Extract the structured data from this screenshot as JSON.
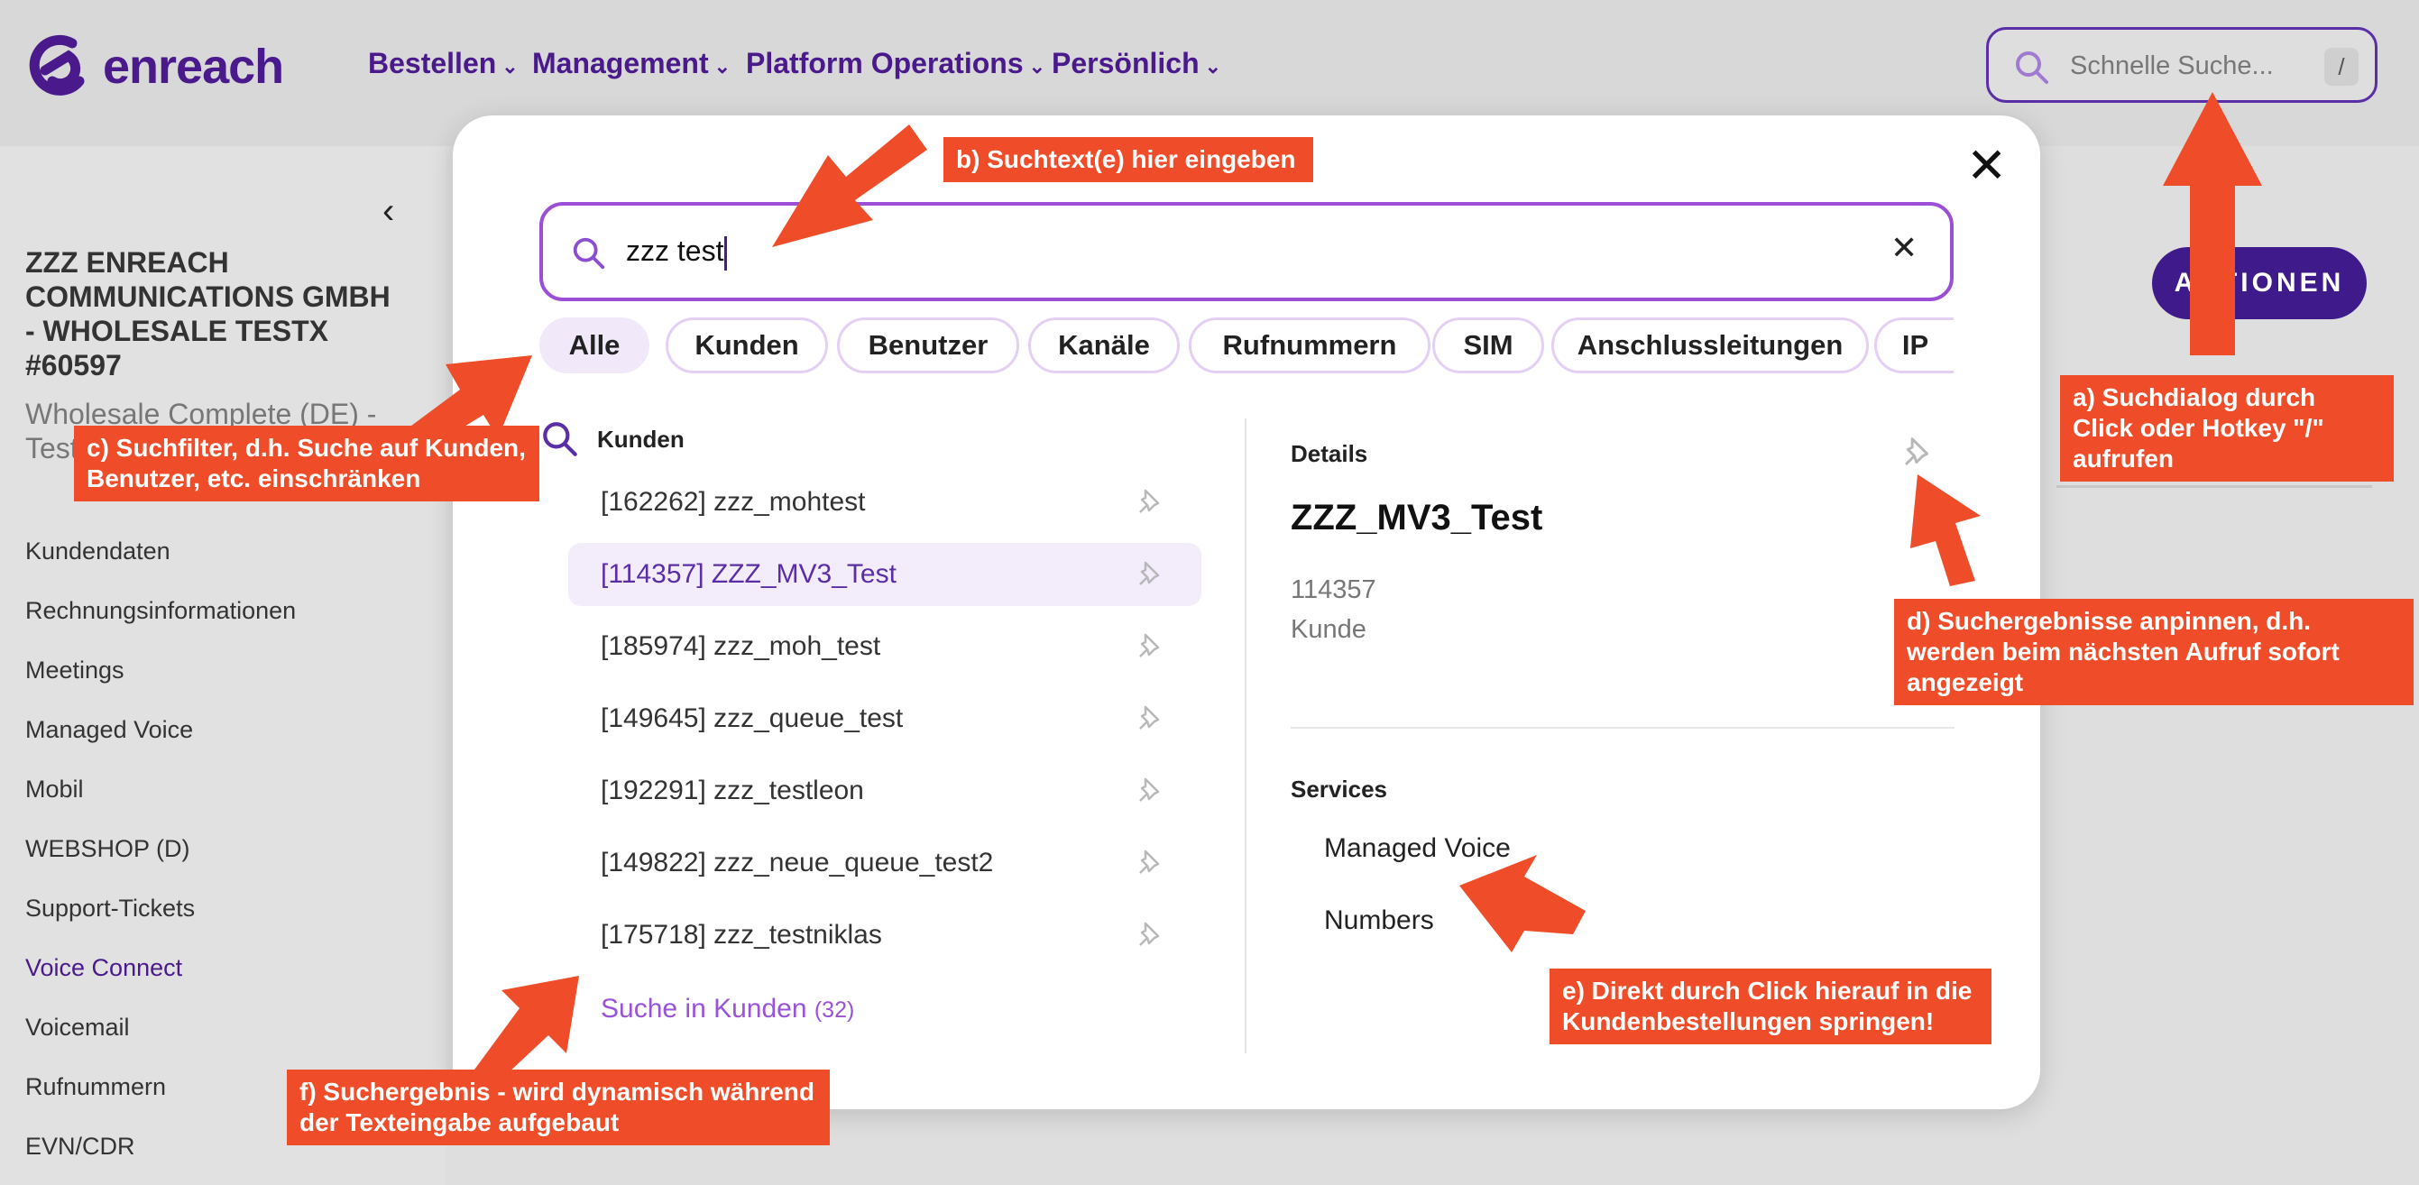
{
  "header": {
    "logo_text": "enreach",
    "nav": [
      "Bestellen",
      "Management",
      "Platform Operations",
      "Persönlich"
    ],
    "quick_search_placeholder": "Schnelle Suche...",
    "quick_search_hotkey": "/"
  },
  "sidebar": {
    "customer_title": "ZZZ ENREACH COMMUNICATIONS GMBH - WHOLESALE TESTX #60597",
    "customer_subtitle": "Wholesale Complete (DE) - Test",
    "items": [
      "Kundendaten",
      "Rechnungsinformationen",
      "Meetings",
      "Managed Voice",
      "Mobil",
      "WEBSHOP (D)",
      "Support-Tickets",
      "Voice Connect",
      "Voicemail",
      "Rufnummern",
      "EVN/CDR"
    ],
    "active_item": "Voice Connect"
  },
  "main": {
    "actions_label": "AKTIONEN"
  },
  "modal": {
    "search_value": "zzz test",
    "filters": [
      "Alle",
      "Kunden",
      "Benutzer",
      "Kanäle",
      "Rufnummern",
      "SIM",
      "Anschlussleitungen",
      "IP"
    ],
    "active_filter": "Alle",
    "section_title": "Kunden",
    "results": [
      "[162262] zzz_mohtest",
      "[114357] ZZZ_MV3_Test",
      "[185974] zzz_moh_test",
      "[149645] zzz_queue_test",
      "[192291] zzz_testleon",
      "[149822] zzz_neue_queue_test2",
      "[175718] zzz_testniklas"
    ],
    "selected_result": "[114357] ZZZ_MV3_Test",
    "more_link": "Suche in Kunden",
    "more_count": "(32)",
    "details": {
      "heading": "Details",
      "title": "ZZZ_MV3_Test",
      "id": "114357",
      "type": "Kunde",
      "services_heading": "Services",
      "services": [
        "Managed Voice",
        "Numbers"
      ]
    }
  },
  "annotations": {
    "a": "a) Suchdialog durch Click oder Hotkey \"/\" aufrufen",
    "b": "b) Suchtext(e) hier eingeben",
    "c": "c) Suchfilter, d.h. Suche auf Kunden, Benutzer, etc. einschränken",
    "d": "d) Suchergebnisse anpinnen, d.h. werden beim nächsten Aufruf sofort angezeigt",
    "e": "e) Direkt durch Click hierauf in die Kundenbestellungen springen!",
    "f": "f) Suchergebnis - wird dynamisch während der Texteingabe aufgebaut"
  },
  "colors": {
    "brand": "#4a1a8c",
    "accent": "#9b4fd6",
    "annotation": "#ef4d29"
  }
}
